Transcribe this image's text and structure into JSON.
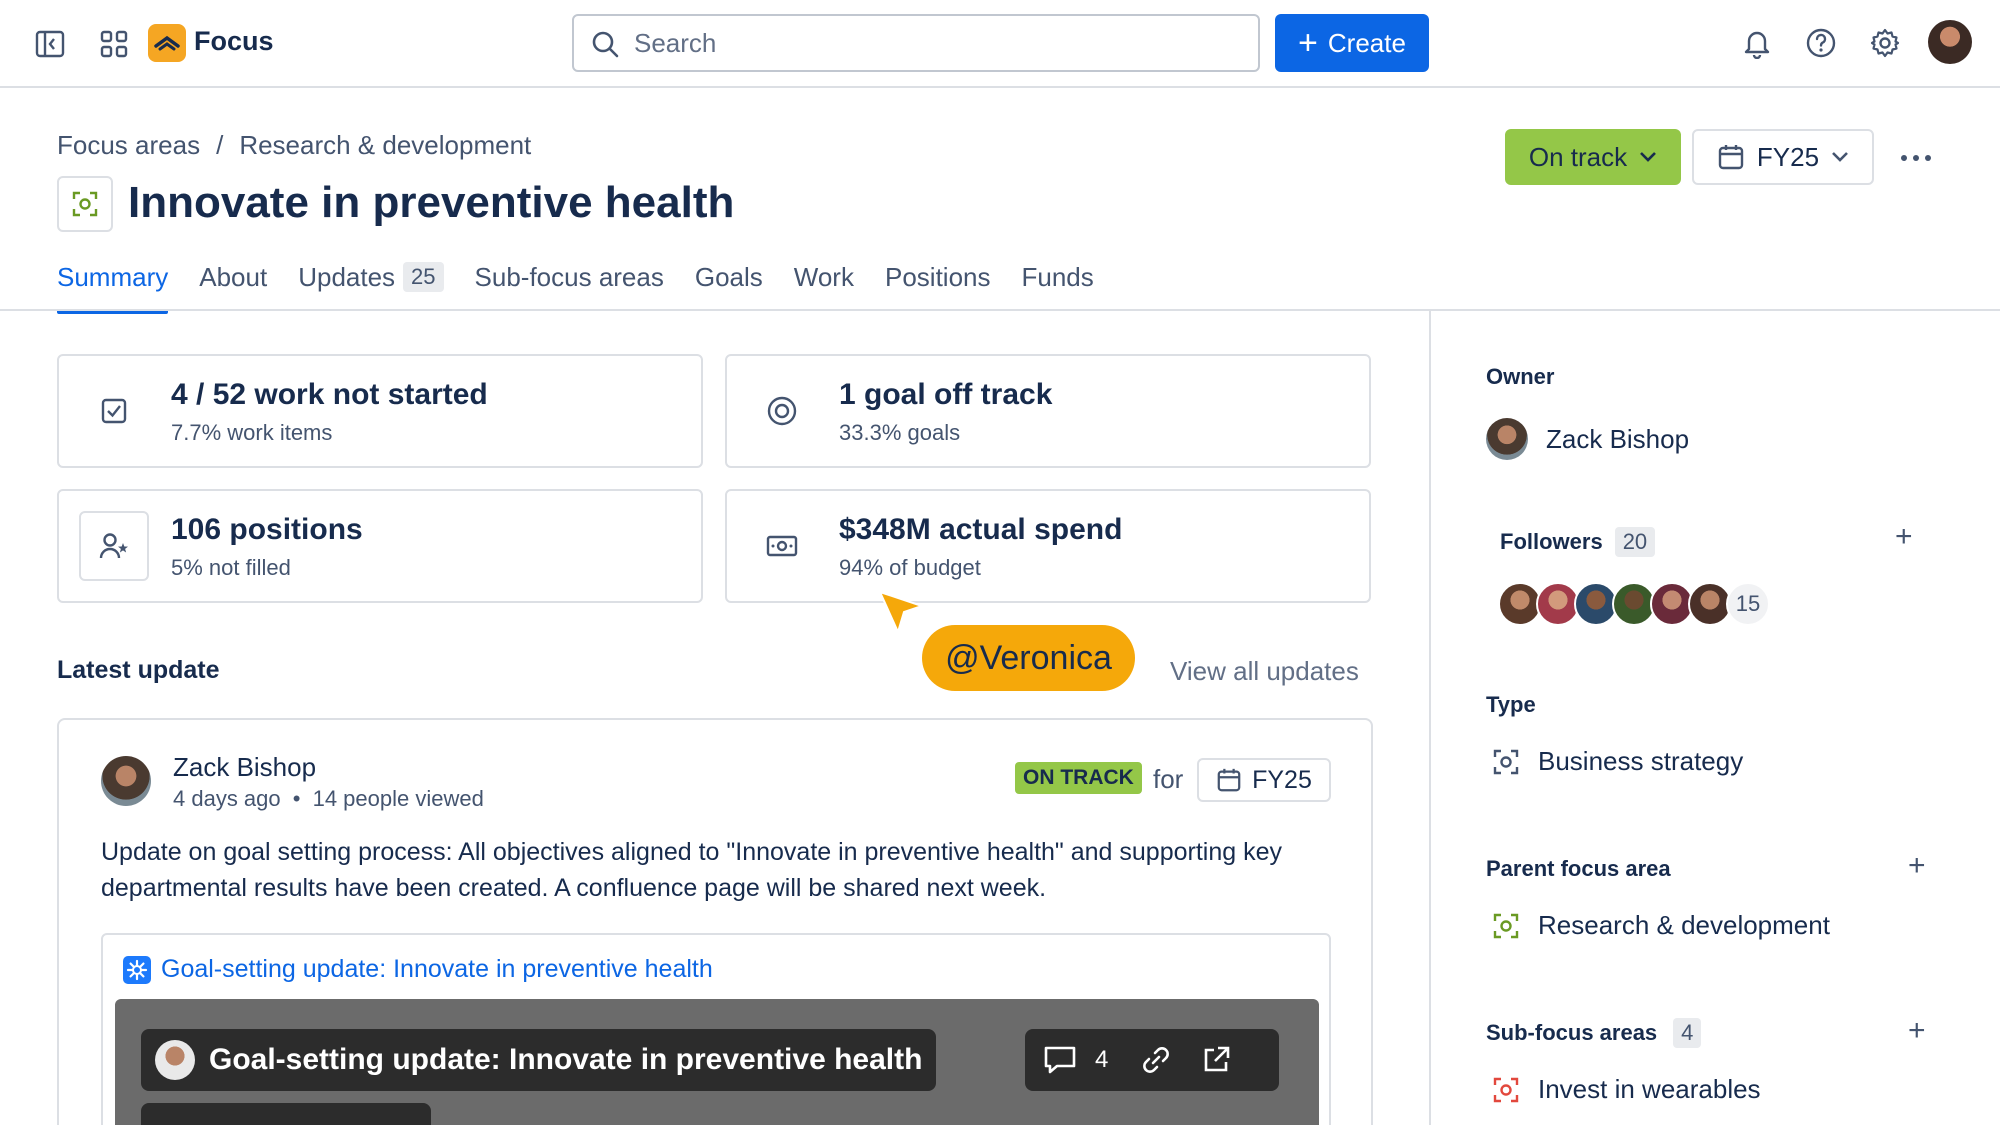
{
  "nav": {
    "app_name": "Focus",
    "search_placeholder": "Search",
    "create_label": "Create"
  },
  "header": {
    "breadcrumb": [
      "Focus areas",
      "Research & development"
    ],
    "breadcrumb_separator": "/",
    "title": "Innovate in preventive health",
    "status_label": "On track",
    "period_label": "FY25"
  },
  "tabs": [
    {
      "label": "Summary",
      "active": true
    },
    {
      "label": "About"
    },
    {
      "label": "Updates",
      "count": "25"
    },
    {
      "label": "Sub-focus areas"
    },
    {
      "label": "Goals"
    },
    {
      "label": "Work"
    },
    {
      "label": "Positions"
    },
    {
      "label": "Funds"
    }
  ],
  "metrics": [
    {
      "title": "4 / 52 work not started",
      "subtitle": "7.7% work items",
      "icon": "checkbox-icon"
    },
    {
      "title": "1 goal off track",
      "subtitle": "33.3% goals",
      "icon": "target-icon"
    },
    {
      "title": "106 positions",
      "subtitle": "5% not filled",
      "icon": "person-star-icon"
    },
    {
      "title": "$348M actual spend",
      "subtitle": "94% of budget",
      "icon": "money-icon"
    }
  ],
  "latest_update": {
    "section_title": "Latest update",
    "view_all": "View all updates",
    "cursor_label": "@Veronica",
    "author": "Zack Bishop",
    "time": "4 days ago",
    "views": "14 people viewed",
    "status": "ON TRACK",
    "for_label": "for",
    "period": "FY25",
    "body": "Update on goal setting process: All objectives aligned to \"Innovate in preventive health\" and supporting key departmental results have been created. A confluence page will be shared next week.",
    "embed_link": "Goal-setting update: Innovate in preventive health",
    "embed_title": "Goal-setting update: Innovate in preventive health",
    "embed_comments": "4"
  },
  "sidebar": {
    "owner_label": "Owner",
    "owner_name": "Zack Bishop",
    "followers_label": "Followers",
    "followers_count": "20",
    "followers_more": "15",
    "type_label": "Type",
    "type_value": "Business strategy",
    "parent_label": "Parent focus area",
    "parent_value": "Research & development",
    "sub_label": "Sub-focus areas",
    "sub_count": "4",
    "sub_first": "Invest in wearables"
  },
  "colors": {
    "accent": "#0c66e4",
    "on_track": "#94c748",
    "cursor": "#f5a80a",
    "logo": "#f5a623"
  }
}
